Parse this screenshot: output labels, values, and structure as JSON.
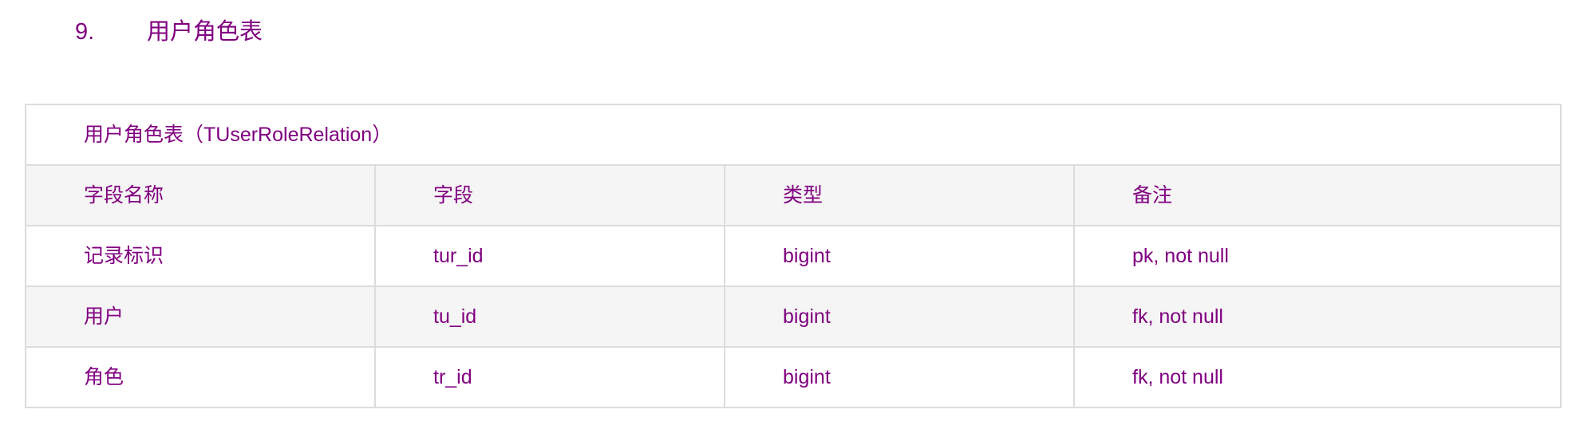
{
  "heading": {
    "number": "9.",
    "title": "用户角色表"
  },
  "table": {
    "caption": "用户角色表（TUserRoleRelation）",
    "columns": [
      "字段名称",
      "字段",
      "类型",
      "备注"
    ],
    "rows": [
      [
        "记录标识",
        "tur_id",
        "bigint",
        "pk, not null"
      ],
      [
        "用户",
        "tu_id",
        "bigint",
        "fk, not null"
      ],
      [
        "角色",
        "tr_id",
        "bigint",
        "fk, not null"
      ]
    ]
  },
  "colors": {
    "text": "#800080",
    "border": "#dcdcdc",
    "stripe": "#f5f5f5"
  }
}
